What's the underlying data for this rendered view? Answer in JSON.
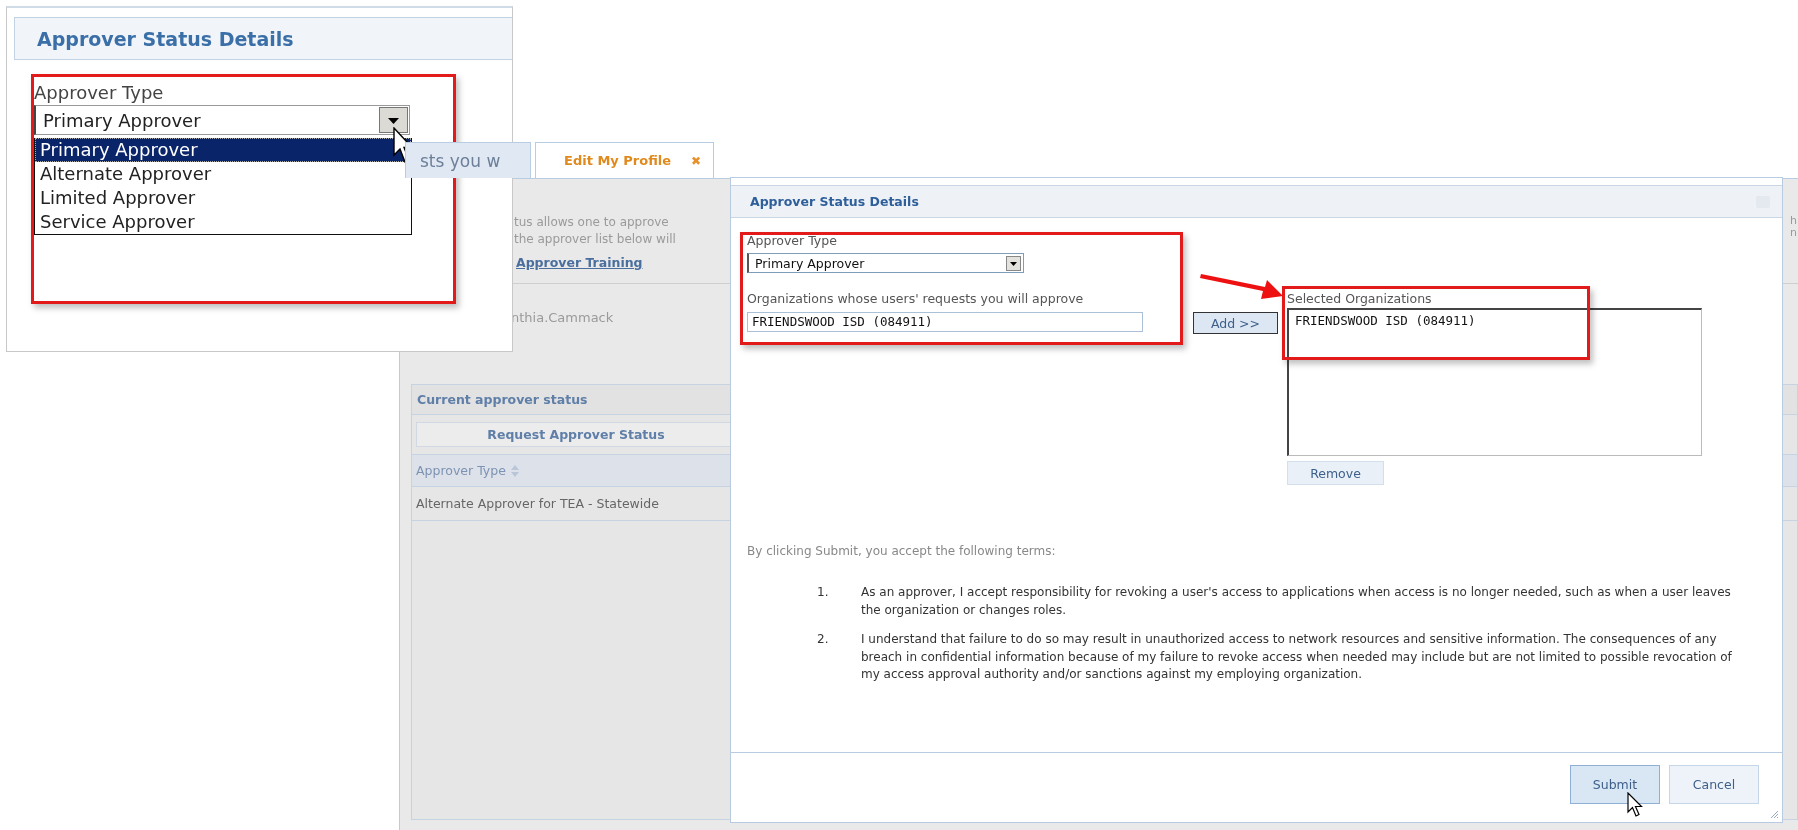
{
  "background": {
    "tabs": [
      {
        "label": "sts you w",
        "selected": false
      },
      {
        "label": "Edit My Profile",
        "selected": true,
        "close": "✖"
      }
    ],
    "intro_lines": [
      "tus allows one to approve",
      "the approver list below will"
    ],
    "training_link": "Approver Training",
    "user_name": "nthia.Cammack",
    "status_panel": {
      "title": "Current approver status",
      "request_button": "Request Approver Status",
      "columns": [
        {
          "label": "Approver Type",
          "sortable": true
        }
      ],
      "rows": [
        "Alternate Approver for TEA - Statewide"
      ]
    },
    "right_edge_text": [
      "h",
      "n"
    ]
  },
  "dialog": {
    "title": "Approver Status Details",
    "approver_type_label": "Approver Type",
    "approver_type_value": "Primary Approver",
    "organizations_label": "Organizations whose users' requests you will approve",
    "organization_value": "FRIENDSWOOD ISD (084911)",
    "add_button": "Add >>",
    "selected_label": "Selected Organizations",
    "selected_items": [
      "FRIENDSWOOD ISD (084911)"
    ],
    "remove_button": "Remove",
    "terms_intro": "By clicking Submit, you accept the following terms:",
    "terms": [
      {
        "number": "1.",
        "text": "As an approver, I accept responsibility for revoking a user's access to applications when access is no longer needed, such as when a user leaves the organization or changes roles."
      },
      {
        "number": "2.",
        "text": "I understand that failure to do so may result in unauthorized access to network resources and sensitive information. The consequences of any breach in confidential information because of my failure to revoke access when needed may include but are not limited to possible revocation of my access approval authority and/or sanctions against my employing organization."
      }
    ],
    "buttons": [
      {
        "label": "Submit",
        "focused": true
      },
      {
        "label": "Cancel",
        "focused": false
      }
    ]
  },
  "inset": {
    "title": "Approver Status Details",
    "field_label": "Approver Type",
    "select_value": "Primary Approver",
    "options": [
      {
        "label": "Primary Approver",
        "selected": true
      },
      {
        "label": "Alternate Approver",
        "selected": false
      },
      {
        "label": "Limited Approver",
        "selected": false
      },
      {
        "label": "Service Approver",
        "selected": false
      }
    ]
  }
}
